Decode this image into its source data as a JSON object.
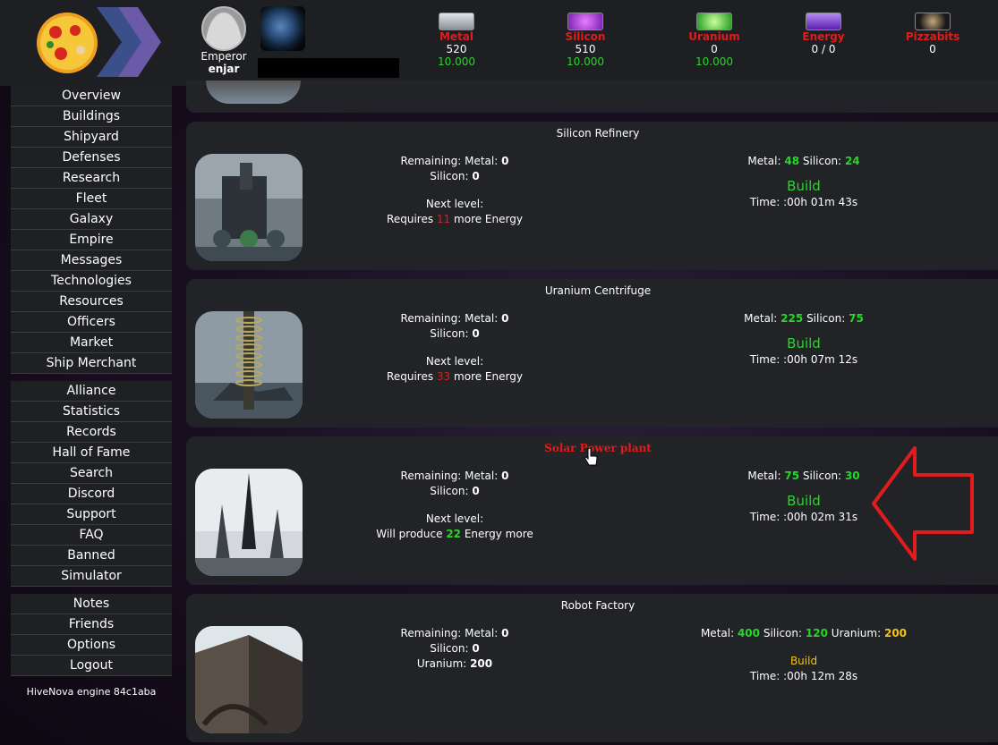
{
  "header": {
    "emperor_label": "Emperor",
    "emperor_name": "enjar",
    "resources": [
      {
        "name": "Metal",
        "value": "520",
        "production": "10.000",
        "color": "#b7bcc2"
      },
      {
        "name": "Silicon",
        "value": "510",
        "production": "10.000",
        "color": "#a53be0"
      },
      {
        "name": "Uranium",
        "value": "0",
        "production": "10.000",
        "color": "#38d22a"
      },
      {
        "name": "Energy",
        "value": "0 / 0",
        "production": "",
        "color": "#8a46e8"
      },
      {
        "name": "Pizzabits",
        "value": "0",
        "production": "",
        "color": "#333"
      }
    ]
  },
  "sidebar": {
    "group1": [
      "Overview",
      "Buildings",
      "Shipyard",
      "Defenses",
      "Research",
      "Fleet",
      "Galaxy",
      "Empire",
      "Messages",
      "Technologies",
      "Resources",
      "Officers",
      "Market",
      "Ship Merchant"
    ],
    "group2": [
      "Alliance",
      "Statistics",
      "Records",
      "Hall of Fame",
      "Search",
      "Discord",
      "Support",
      "FAQ",
      "Banned",
      "Simulator"
    ],
    "group3": [
      "Notes",
      "Friends",
      "Options",
      "Logout"
    ],
    "engine": "HiveNova engine 84c1aba"
  },
  "buildings": [
    {
      "title": "Silicon Refinery",
      "remaining_metal_label": "Remaining: Metal:",
      "remaining_metal": "0",
      "remaining_silicon_label": "Silicon:",
      "remaining_silicon": "0",
      "next_level_label": "Next level:",
      "requirement_prefix": "Requires",
      "requirement_value": "11",
      "requirement_suffix": "more Energy",
      "cost_metal_label": "Metal:",
      "cost_metal": "48",
      "cost_silicon_label": "Silicon:",
      "cost_silicon": "24",
      "build_label": "Build",
      "time": "Time: :00h 01m 43s"
    },
    {
      "title": "Uranium Centrifuge",
      "remaining_metal_label": "Remaining: Metal:",
      "remaining_metal": "0",
      "remaining_silicon_label": "Silicon:",
      "remaining_silicon": "0",
      "next_level_label": "Next level:",
      "requirement_prefix": "Requires",
      "requirement_value": "33",
      "requirement_suffix": "more Energy",
      "cost_metal_label": "Metal:",
      "cost_metal": "225",
      "cost_silicon_label": "Silicon:",
      "cost_silicon": "75",
      "build_label": "Build",
      "time": "Time: :00h 07m 12s"
    },
    {
      "title": "Solar Power plant",
      "remaining_metal_label": "Remaining: Metal:",
      "remaining_metal": "0",
      "remaining_silicon_label": "Silicon:",
      "remaining_silicon": "0",
      "next_level_label": "Next level:",
      "requirement_prefix": "Will produce",
      "requirement_value": "22",
      "requirement_suffix": "Energy more",
      "cost_metal_label": "Metal:",
      "cost_metal": "75",
      "cost_silicon_label": "Silicon:",
      "cost_silicon": "30",
      "build_label": "Build",
      "time": "Time: :00h 02m 31s"
    },
    {
      "title": "Robot Factory",
      "remaining_metal_label": "Remaining: Metal:",
      "remaining_metal": "0",
      "remaining_silicon_label": "Silicon:",
      "remaining_silicon": "0",
      "remaining_uranium_label": "Uranium:",
      "remaining_uranium": "200",
      "cost_metal_label": "Metal:",
      "cost_metal": "400",
      "cost_silicon_label": "Silicon:",
      "cost_silicon": "120",
      "cost_uranium_label": "Uranium:",
      "cost_uranium": "200",
      "build_label": "Build",
      "time": "Time: :00h 12m 28s"
    }
  ]
}
